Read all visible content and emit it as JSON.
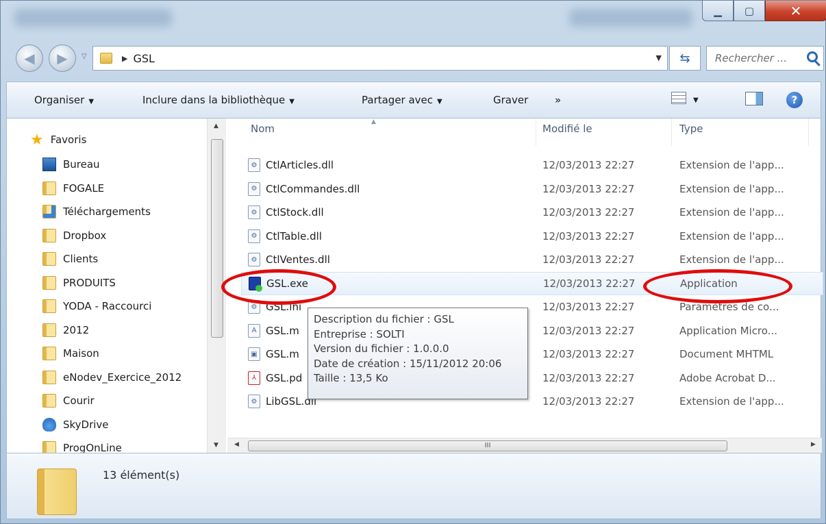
{
  "window": {
    "title": "GSL"
  },
  "address": {
    "crumbs": [
      "GSL"
    ],
    "search_placeholder": "Rechercher ..."
  },
  "toolbar": {
    "organize": "Organiser",
    "include": "Inclure dans la bibliothèque",
    "share": "Partager avec",
    "burn": "Graver",
    "more": "»"
  },
  "sidebar": {
    "favorites": "Favoris",
    "items": [
      {
        "label": "Bureau",
        "icon": "desktop-icon"
      },
      {
        "label": "FOGALE",
        "icon": "folder-icon"
      },
      {
        "label": "Téléchargements",
        "icon": "downloads-icon"
      },
      {
        "label": "Dropbox",
        "icon": "folder-icon"
      },
      {
        "label": "Clients",
        "icon": "folder-icon"
      },
      {
        "label": "PRODUITS",
        "icon": "folder-icon"
      },
      {
        "label": "YODA - Raccourci",
        "icon": "folder-icon"
      },
      {
        "label": "2012",
        "icon": "folder-icon"
      },
      {
        "label": "Maison",
        "icon": "folder-icon"
      },
      {
        "label": "eNodev_Exercice_2012",
        "icon": "folder-icon"
      },
      {
        "label": "Courir",
        "icon": "folder-icon"
      },
      {
        "label": "SkyDrive",
        "icon": "skydrive-icon"
      },
      {
        "label": "ProgOnLine",
        "icon": "folder-icon"
      }
    ]
  },
  "columns": {
    "name": "Nom",
    "modified": "Modifié le",
    "type": "Type"
  },
  "files": [
    {
      "name": "CtlArticles.dll",
      "date": "12/03/2013 22:27",
      "type": "Extension de l'app...",
      "icon": "dll-icon"
    },
    {
      "name": "CtlCommandes.dll",
      "date": "12/03/2013 22:27",
      "type": "Extension de l'app...",
      "icon": "dll-icon"
    },
    {
      "name": "CtlStock.dll",
      "date": "12/03/2013 22:27",
      "type": "Extension de l'app...",
      "icon": "dll-icon"
    },
    {
      "name": "CtlTable.dll",
      "date": "12/03/2013 22:27",
      "type": "Extension de l'app...",
      "icon": "dll-icon"
    },
    {
      "name": "CtlVentes.dll",
      "date": "12/03/2013 22:27",
      "type": "Extension de l'app...",
      "icon": "dll-icon"
    },
    {
      "name": "GSL.exe",
      "date": "12/03/2013 22:27",
      "type": "Application",
      "icon": "exe-icon"
    },
    {
      "name": "GSL.ini",
      "date": "12/03/2013 22:27",
      "type": "Paramètres de co...",
      "icon": "ini-icon"
    },
    {
      "name": "GSL.m",
      "date": "12/03/2013 22:27",
      "type": "Application Micro...",
      "icon": "access-icon"
    },
    {
      "name": "GSL.m",
      "date": "12/03/2013 22:27",
      "type": "Document MHTML",
      "icon": "mhtml-icon"
    },
    {
      "name": "GSL.pd",
      "date": "12/03/2013 22:27",
      "type": "Adobe Acrobat D...",
      "icon": "pdf-icon"
    },
    {
      "name": "LibGSL.dll",
      "date": "12/03/2013 22:27",
      "type": "Extension de l'app...",
      "icon": "dll-icon"
    }
  ],
  "tooltip": {
    "lines": [
      "Description du fichier : GSL",
      "Entreprise : SOLTI",
      "Version du fichier : 1.0.0.0",
      "Date de création : 15/11/2012 20:06",
      "Taille : 13,5 Ko"
    ]
  },
  "status": {
    "count": "13 élément(s)"
  },
  "colors": {
    "annotation": "#e00c0c",
    "accent": "#2a66b0"
  }
}
